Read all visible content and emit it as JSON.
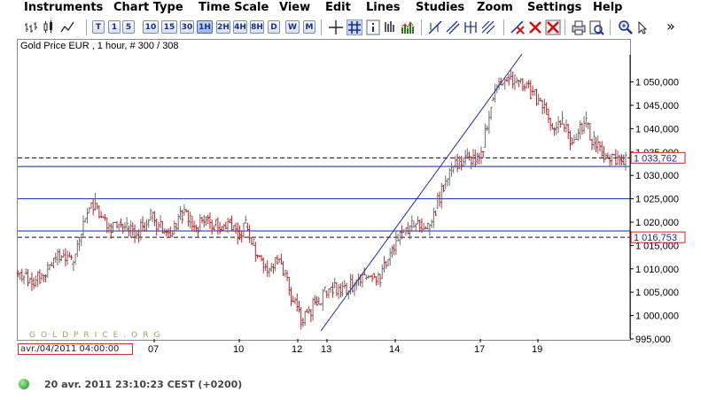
{
  "menu": [
    "Instruments",
    "Chart Type",
    "Time Scale",
    "View",
    "Edit",
    "Lines",
    "Studies",
    "Zoom",
    "Settings",
    "Help"
  ],
  "toolbar": {
    "timeframes": [
      "T",
      "1",
      "5",
      "10",
      "15",
      "30",
      "1H",
      "2H",
      "4H",
      "8H",
      "D",
      "W",
      "M"
    ],
    "active_timeframe": "1H",
    "icons": [
      "bar-chart-icon",
      "line-chart-icon",
      "crosshair-icon",
      "grid-icon",
      "info-icon",
      "volume-icon",
      "trendline-icon",
      "channel-icon",
      "fibonacci-icon",
      "delete-line-icon",
      "delete-all-icon",
      "print-icon",
      "print-preview-icon",
      "zoom-in-icon",
      "more-icon"
    ],
    "more_label": "»"
  },
  "chart": {
    "title": "Gold Price EUR , 1 hour, # 300 / 308",
    "watermark": "GOLDPRICE.ORG",
    "cursor_date": "avr./04/2011 04:00:00",
    "price_labels": [
      "1 033,762",
      "1 016,753"
    ],
    "colors": {
      "up": "#6d6d6d",
      "down": "#c0202a",
      "line": "#1a2aa0",
      "label_border": "#cc2222"
    }
  },
  "chart_data": {
    "type": "bar",
    "title": "Gold Price EUR , 1 hour, # 300 / 308",
    "ylim": [
      995000,
      1055000
    ],
    "y_ticks": [
      "1 050,000",
      "1 045,000",
      "1 040,000",
      "1 035,000",
      "1 030,000",
      "1 025,000",
      "1 020,000",
      "1 015,000",
      "1 010,000",
      "1 005,000",
      "1 000,000",
      "995,000"
    ],
    "x_ticks": [
      "07",
      "10",
      "12",
      "13",
      "14",
      "17",
      "19"
    ],
    "horizontal_lines": [
      1033762,
      1031900,
      1025000,
      1018100,
      1016753
    ],
    "dashed_lines": [
      1033762,
      1016753
    ],
    "series": [
      {
        "values": [
          1009000,
          1007500,
          1008000,
          1010000,
          1012000,
          1013000,
          1011000,
          1016000,
          1022000,
          1024000,
          1021000,
          1019000,
          1020000,
          1018500,
          1017000,
          1019000,
          1021000,
          1019500,
          1018000,
          1019000,
          1022000,
          1020000,
          1019000,
          1021000,
          1019500,
          1019000,
          1020500,
          1018000,
          1019000,
          1015000,
          1012000,
          1010000,
          1012000,
          1009000,
          1003000,
          999000,
          1001000,
          1003000,
          1005000,
          1006000,
          1004500,
          1006000,
          1007500,
          1008000,
          1009000,
          1008000,
          1012000,
          1016000,
          1017500,
          1019000,
          1020000,
          1018500,
          1023000,
          1028000,
          1031000,
          1033000,
          1034000,
          1033000,
          1036000,
          1046000,
          1050000,
          1051000,
          1050000,
          1049000,
          1048000,
          1046000,
          1043000,
          1040000,
          1041000,
          1038000,
          1039000,
          1041000,
          1037000,
          1035000,
          1033000,
          1034000,
          1033762
        ]
      }
    ]
  },
  "status": {
    "timestamp": "20 avr. 2011 23:10:23  CEST (+0200)"
  }
}
